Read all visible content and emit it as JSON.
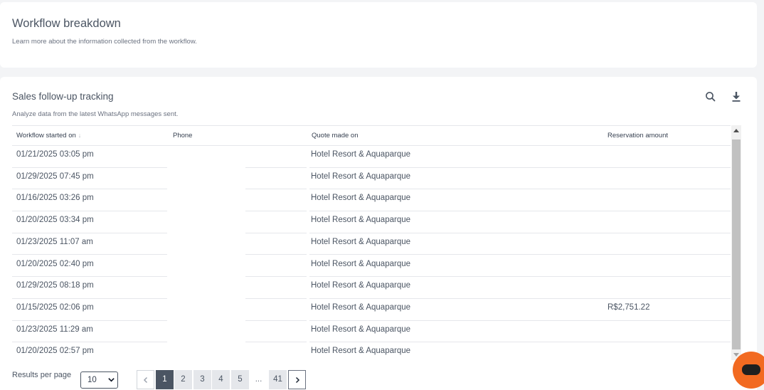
{
  "header": {
    "title": "Workflow breakdown",
    "subtitle": "Learn more about the information collected from the workflow."
  },
  "report": {
    "title": "Sales follow-up tracking",
    "subtitle": "Analyze data from the latest WhatsApp messages sent.",
    "icons": {
      "search": "search-icon",
      "download": "download-icon"
    }
  },
  "table": {
    "columns": [
      "Workflow started on",
      "Phone",
      "Quote made on",
      "Reservation amount"
    ],
    "sort_indicator": "↓",
    "rows": [
      {
        "started": "01/21/2025 03:05 pm",
        "phone": "",
        "quote": "Hotel Resort & Aquaparque",
        "amount": ""
      },
      {
        "started": "01/29/2025 07:45 pm",
        "phone": "",
        "quote": "Hotel Resort & Aquaparque",
        "amount": ""
      },
      {
        "started": "01/16/2025 03:26 pm",
        "phone": "",
        "quote": "Hotel Resort & Aquaparque",
        "amount": ""
      },
      {
        "started": "01/20/2025 03:34 pm",
        "phone": "",
        "quote": "Hotel Resort & Aquaparque",
        "amount": ""
      },
      {
        "started": "01/23/2025 11:07 am",
        "phone": "",
        "quote": "Hotel Resort & Aquaparque",
        "amount": ""
      },
      {
        "started": "01/20/2025 02:40 pm",
        "phone": "",
        "quote": "Hotel Resort & Aquaparque",
        "amount": ""
      },
      {
        "started": "01/29/2025 08:18 pm",
        "phone": "",
        "quote": "Hotel Resort & Aquaparque",
        "amount": ""
      },
      {
        "started": "01/15/2025 02:06 pm",
        "phone": "",
        "quote": "Hotel Resort & Aquaparque",
        "amount": "R$2,751.22"
      },
      {
        "started": "01/23/2025 11:29 am",
        "phone": "",
        "quote": "Hotel Resort & Aquaparque",
        "amount": ""
      },
      {
        "started": "01/20/2025 02:57 pm",
        "phone": "",
        "quote": "Hotel Resort & Aquaparque",
        "amount": ""
      }
    ]
  },
  "pagination": {
    "results_per_page_label": "Results per page",
    "results_per_page": "10",
    "pages": [
      "1",
      "2",
      "3",
      "4",
      "5"
    ],
    "ellipsis": "...",
    "last_page": "41",
    "current_page": "1"
  },
  "colors": {
    "accent": "#4b5563",
    "chat_button": "#f26a21",
    "background": "#f3f4f6"
  }
}
